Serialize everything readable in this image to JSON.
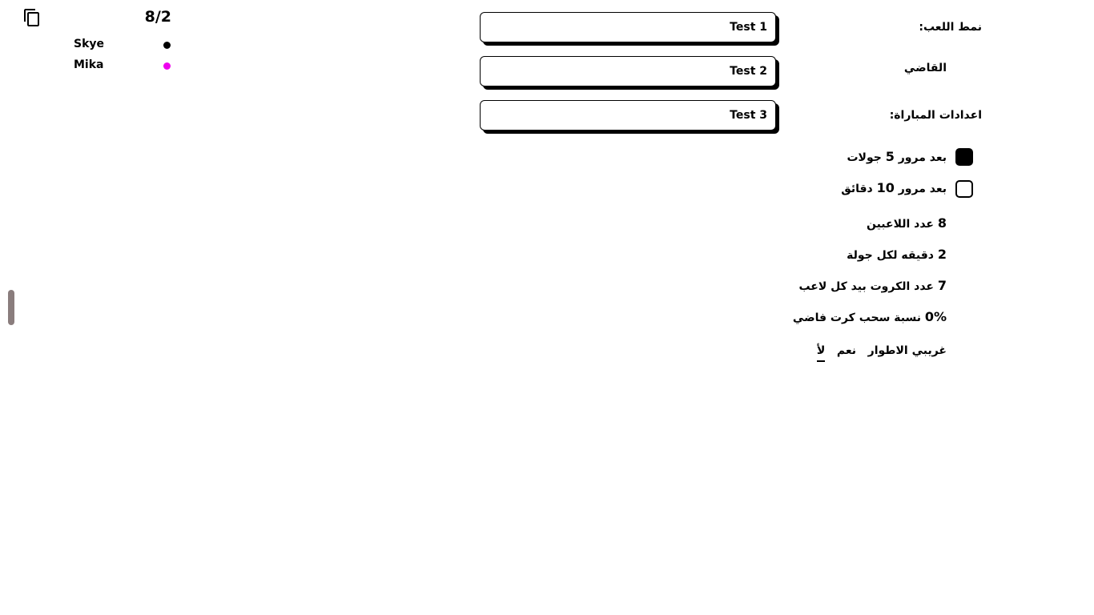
{
  "lobby": {
    "players_count": "8/2",
    "players": [
      {
        "name": "Skye",
        "color": "#000000"
      },
      {
        "name": "Mika",
        "color": "#ee00ee"
      }
    ]
  },
  "options": [
    {
      "label": "Test 1"
    },
    {
      "label": "Test 2"
    },
    {
      "label": "Test 3"
    }
  ],
  "settings": {
    "game_mode_label": "نمط اللعب:",
    "judge_label": "القاضي",
    "match_settings_label": "اعدادات المباراة:",
    "end_after_rounds": {
      "prefix": "بعد مرور",
      "value": "5",
      "suffix": "جولات",
      "checked": true
    },
    "end_after_minutes": {
      "prefix": "بعد مرور",
      "value": "10",
      "suffix": "دقائق",
      "checked": false
    },
    "players_number": {
      "value": "8",
      "label": "عدد اللاعبين"
    },
    "minutes_per_round": {
      "value": "2",
      "label": "دقيقه لكل جولة"
    },
    "cards_per_player": {
      "value": "7",
      "label": "عدد الكروت بيد كل لاعب"
    },
    "blank_card_ratio": {
      "value": "0%",
      "label": "نسبة سحب كرت فاضي"
    },
    "weird_mode": {
      "label": "غريبي الاطوار",
      "yes": "نعم",
      "no": "لأ",
      "selected": "no"
    }
  },
  "icons": {
    "copy": "copy-icon"
  }
}
